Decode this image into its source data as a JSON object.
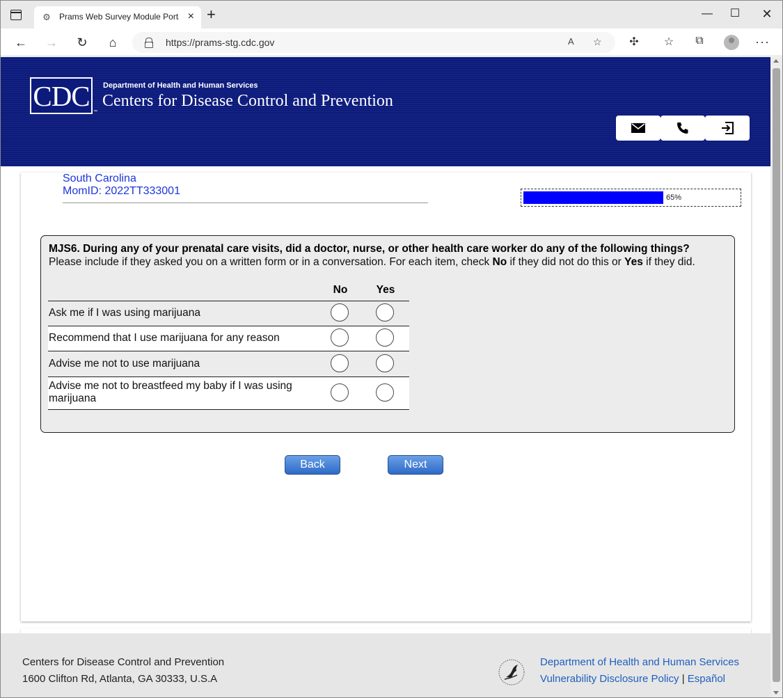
{
  "browser": {
    "tab_title": "Prams Web Survey Module Porta",
    "url": "https://prams-stg.cdc.gov",
    "icons": [
      "tab-actions-icon",
      "page-favicon-icon",
      "close-icon",
      "new-tab-icon",
      "minimize-icon",
      "maximize-icon",
      "window-close-icon",
      "back-icon",
      "forward-icon",
      "refresh-icon",
      "home-icon",
      "lock-icon",
      "read-aloud-icon",
      "add-favorite-icon",
      "extensions-icon",
      "favorites-icon",
      "collections-icon",
      "profile-icon",
      "more-icon"
    ]
  },
  "header": {
    "logo_text": "CDC",
    "logo_tm": "™",
    "department": "Department of Health and Human Services",
    "agency": "Centers for Disease Control and Prevention",
    "buttons": [
      "mail-icon",
      "phone-icon",
      "logout-icon"
    ]
  },
  "respondent": {
    "state": "South Carolina",
    "mom_id": "MomID: 2022TT333001"
  },
  "progress": {
    "percent": 65,
    "label": "65%"
  },
  "question": {
    "title": "MJS6. During any of your prenatal care visits, did a doctor, nurse, or other health care worker do any of the following things?",
    "instruction_pre": "Please include if they asked you on a written form or in a conversation. For each item, check ",
    "instruction_no": "No",
    "instruction_mid": " if they did not do this or ",
    "instruction_yes": "Yes",
    "instruction_post": " if they did.",
    "col_no": "No",
    "col_yes": "Yes",
    "items": [
      {
        "label": "Ask me if I was using marijuana"
      },
      {
        "label": "Recommend that I use marijuana for any reason"
      },
      {
        "label": "Advise me not to use marijuana"
      },
      {
        "label": "Advise me not to breastfeed my baby if I was using marijuana"
      }
    ]
  },
  "nav": {
    "back": "Back",
    "next": "Next"
  },
  "footer": {
    "org": "Centers for Disease Control and Prevention",
    "address": "1600 Clifton Rd, Atlanta, GA 30333, U.S.A",
    "link_hhs": "Department of Health and Human Services",
    "link_vdp": "Vulnerability Disclosure Policy",
    "separator": "|",
    "link_es": "Español"
  },
  "colors": {
    "header_bg": "#0c1a7c",
    "progress_fill": "#0000ff",
    "link_blue": "#1e35d8",
    "button_blue": "#2e6ac8"
  }
}
